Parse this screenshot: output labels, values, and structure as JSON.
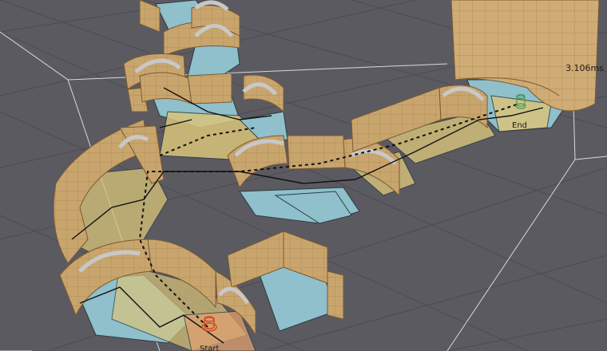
{
  "viewport": {
    "timing": "3.106ms",
    "end_label": "End",
    "start_label": "Start"
  },
  "colors": {
    "background": "#5b5a61",
    "grid": "#4c4b52",
    "wall": "#c9a56e",
    "navmesh": "#8fc0cc",
    "path_highlight": "#d9c47a",
    "start_marker": "#d24a22",
    "end_marker": "#4a9a5a"
  }
}
